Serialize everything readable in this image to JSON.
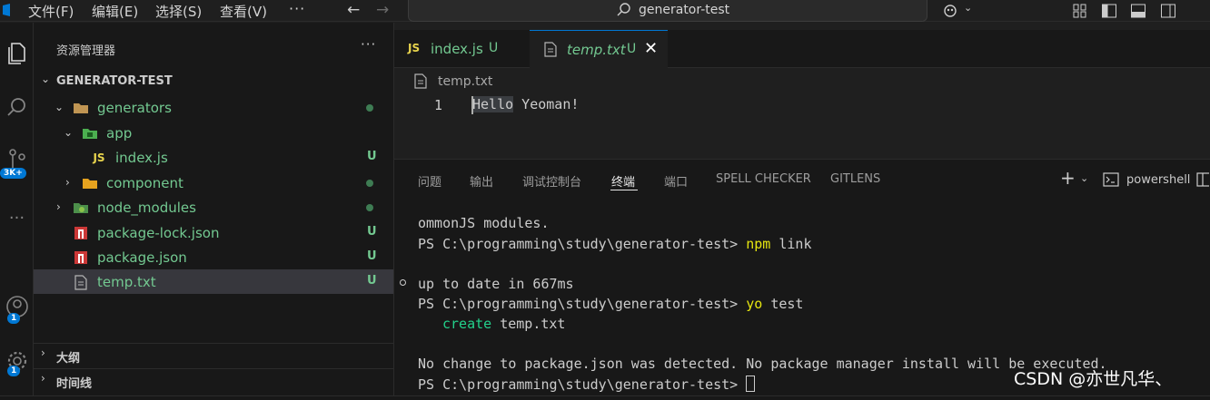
{
  "titlebar": {
    "menus": [
      "文件(F)",
      "编辑(E)",
      "选择(S)",
      "查看(V)"
    ],
    "more": "···",
    "search_text": "generator-test"
  },
  "activity": {
    "badge_ext": "3K+",
    "badge_account": "1",
    "badge_settings": "1"
  },
  "sidebar": {
    "title": "资源管理器",
    "more": "···",
    "root": "GENERATOR-TEST",
    "items": [
      {
        "label": "generators",
        "indicator": "dot"
      },
      {
        "label": "app",
        "indicator": ""
      },
      {
        "label": "index.js",
        "indicator": "U"
      },
      {
        "label": "component",
        "indicator": "dot"
      },
      {
        "label": "node_modules",
        "indicator": "dot"
      },
      {
        "label": "package-lock.json",
        "indicator": "U"
      },
      {
        "label": "package.json",
        "indicator": "U"
      },
      {
        "label": "temp.txt",
        "indicator": "U"
      }
    ],
    "outline": "大纲",
    "timeline": "时间线"
  },
  "editor": {
    "tabs": [
      {
        "label": "index.js",
        "status": "U",
        "icon": "js-icon"
      },
      {
        "label": "temp.txt",
        "status": "U",
        "icon": "file-icon"
      }
    ],
    "breadcrumb": "temp.txt",
    "line_number": "1",
    "code_highlight": "Hello",
    "code_rest": " Yeoman!"
  },
  "panel": {
    "tabs": [
      "问题",
      "输出",
      "调试控制台",
      "终端",
      "端口",
      "SPELL CHECKER",
      "GITLENS"
    ],
    "active_tab": "终端",
    "shell": "powershell",
    "terminal": {
      "l1": "ommonJS modules.",
      "prompt": "PS C:\\programming\\study\\generator-test> ",
      "cmd1": "npm",
      "cmd1_rest": " link",
      "l3": "up to date in 667ms",
      "cmd2": "yo",
      "cmd2_rest": " test",
      "create_word": "create",
      "create_file": " temp.txt",
      "l6": "No change to package.json was detected. No package manager install will be executed."
    }
  },
  "watermark": "CSDN @亦世凡华、",
  "colors": {
    "accent": "#0078d4",
    "untracked": "#73c991",
    "yellow": "#e5e510",
    "green": "#23d18b"
  }
}
